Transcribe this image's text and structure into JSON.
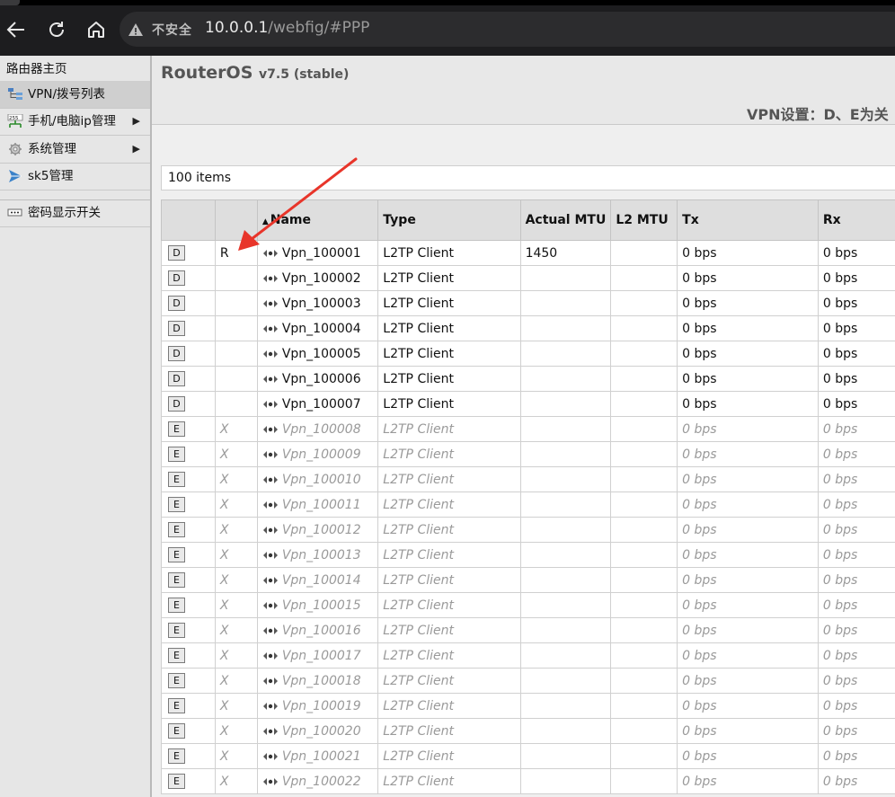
{
  "browser": {
    "security_label": "不安全",
    "url_host": "10.0.0.1",
    "url_rest": "/webfig/#PPP"
  },
  "sidebar": {
    "items": [
      {
        "label": "路由器主页",
        "icon": "",
        "arrow": ""
      },
      {
        "label": "VPN/拨号列表",
        "icon": "network-icon",
        "arrow": ""
      },
      {
        "label": "手机/电脑ip管理",
        "icon": "ip-icon",
        "arrow": "▶"
      },
      {
        "label": "系统管理",
        "icon": "gear-icon",
        "arrow": "▶"
      },
      {
        "label": "sk5管理",
        "icon": "paper-plane-icon",
        "arrow": ""
      },
      {
        "label": "密码显示开关",
        "icon": "password-icon",
        "arrow": ""
      }
    ]
  },
  "header": {
    "title": "RouterOS",
    "version": "v7.5 (stable)",
    "subtitle": "VPN设置：D、E为关"
  },
  "list": {
    "count_label": "100 items",
    "columns": [
      "",
      "",
      "Name",
      "Type",
      "Actual MTU",
      "L2 MTU",
      "Tx",
      "Rx"
    ],
    "sort_indicator": "▲",
    "rows": [
      {
        "flag": "D",
        "status": "R",
        "name": "Vpn_100001",
        "type": "L2TP Client",
        "actual_mtu": "1450",
        "l2_mtu": "",
        "tx": "0 bps",
        "rx": "0 bps"
      },
      {
        "flag": "D",
        "status": "",
        "name": "Vpn_100002",
        "type": "L2TP Client",
        "actual_mtu": "",
        "l2_mtu": "",
        "tx": "0 bps",
        "rx": "0 bps"
      },
      {
        "flag": "D",
        "status": "",
        "name": "Vpn_100003",
        "type": "L2TP Client",
        "actual_mtu": "",
        "l2_mtu": "",
        "tx": "0 bps",
        "rx": "0 bps"
      },
      {
        "flag": "D",
        "status": "",
        "name": "Vpn_100004",
        "type": "L2TP Client",
        "actual_mtu": "",
        "l2_mtu": "",
        "tx": "0 bps",
        "rx": "0 bps"
      },
      {
        "flag": "D",
        "status": "",
        "name": "Vpn_100005",
        "type": "L2TP Client",
        "actual_mtu": "",
        "l2_mtu": "",
        "tx": "0 bps",
        "rx": "0 bps"
      },
      {
        "flag": "D",
        "status": "",
        "name": "Vpn_100006",
        "type": "L2TP Client",
        "actual_mtu": "",
        "l2_mtu": "",
        "tx": "0 bps",
        "rx": "0 bps"
      },
      {
        "flag": "D",
        "status": "",
        "name": "Vpn_100007",
        "type": "L2TP Client",
        "actual_mtu": "",
        "l2_mtu": "",
        "tx": "0 bps",
        "rx": "0 bps"
      },
      {
        "flag": "E",
        "status": "X",
        "name": "Vpn_100008",
        "type": "L2TP Client",
        "actual_mtu": "",
        "l2_mtu": "",
        "tx": "0 bps",
        "rx": "0 bps"
      },
      {
        "flag": "E",
        "status": "X",
        "name": "Vpn_100009",
        "type": "L2TP Client",
        "actual_mtu": "",
        "l2_mtu": "",
        "tx": "0 bps",
        "rx": "0 bps"
      },
      {
        "flag": "E",
        "status": "X",
        "name": "Vpn_100010",
        "type": "L2TP Client",
        "actual_mtu": "",
        "l2_mtu": "",
        "tx": "0 bps",
        "rx": "0 bps"
      },
      {
        "flag": "E",
        "status": "X",
        "name": "Vpn_100011",
        "type": "L2TP Client",
        "actual_mtu": "",
        "l2_mtu": "",
        "tx": "0 bps",
        "rx": "0 bps"
      },
      {
        "flag": "E",
        "status": "X",
        "name": "Vpn_100012",
        "type": "L2TP Client",
        "actual_mtu": "",
        "l2_mtu": "",
        "tx": "0 bps",
        "rx": "0 bps"
      },
      {
        "flag": "E",
        "status": "X",
        "name": "Vpn_100013",
        "type": "L2TP Client",
        "actual_mtu": "",
        "l2_mtu": "",
        "tx": "0 bps",
        "rx": "0 bps"
      },
      {
        "flag": "E",
        "status": "X",
        "name": "Vpn_100014",
        "type": "L2TP Client",
        "actual_mtu": "",
        "l2_mtu": "",
        "tx": "0 bps",
        "rx": "0 bps"
      },
      {
        "flag": "E",
        "status": "X",
        "name": "Vpn_100015",
        "type": "L2TP Client",
        "actual_mtu": "",
        "l2_mtu": "",
        "tx": "0 bps",
        "rx": "0 bps"
      },
      {
        "flag": "E",
        "status": "X",
        "name": "Vpn_100016",
        "type": "L2TP Client",
        "actual_mtu": "",
        "l2_mtu": "",
        "tx": "0 bps",
        "rx": "0 bps"
      },
      {
        "flag": "E",
        "status": "X",
        "name": "Vpn_100017",
        "type": "L2TP Client",
        "actual_mtu": "",
        "l2_mtu": "",
        "tx": "0 bps",
        "rx": "0 bps"
      },
      {
        "flag": "E",
        "status": "X",
        "name": "Vpn_100018",
        "type": "L2TP Client",
        "actual_mtu": "",
        "l2_mtu": "",
        "tx": "0 bps",
        "rx": "0 bps"
      },
      {
        "flag": "E",
        "status": "X",
        "name": "Vpn_100019",
        "type": "L2TP Client",
        "actual_mtu": "",
        "l2_mtu": "",
        "tx": "0 bps",
        "rx": "0 bps"
      },
      {
        "flag": "E",
        "status": "X",
        "name": "Vpn_100020",
        "type": "L2TP Client",
        "actual_mtu": "",
        "l2_mtu": "",
        "tx": "0 bps",
        "rx": "0 bps"
      },
      {
        "flag": "E",
        "status": "X",
        "name": "Vpn_100021",
        "type": "L2TP Client",
        "actual_mtu": "",
        "l2_mtu": "",
        "tx": "0 bps",
        "rx": "0 bps"
      },
      {
        "flag": "E",
        "status": "X",
        "name": "Vpn_100022",
        "type": "L2TP Client",
        "actual_mtu": "",
        "l2_mtu": "",
        "tx": "0 bps",
        "rx": "0 bps"
      }
    ]
  },
  "colors": {
    "annotation_arrow": "#e8352a",
    "disabled_text": "#9a9a9a"
  }
}
